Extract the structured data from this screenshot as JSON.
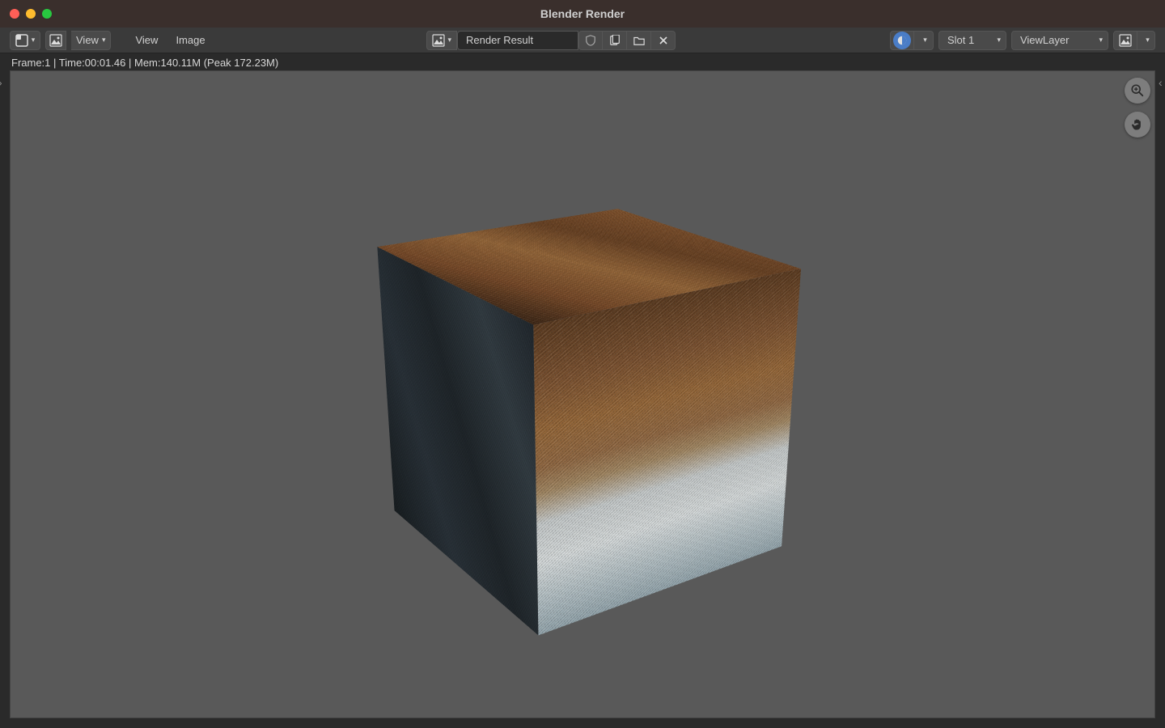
{
  "window": {
    "title": "Blender Render"
  },
  "toolbar": {
    "editor_type_icon": "image-editor-icon",
    "mode_icon": "image-mode-icon",
    "view_dropdown": "View",
    "menus": {
      "view": "View",
      "image": "Image"
    },
    "image_selector_icon": "image-datablock-icon",
    "image_name": "Render Result",
    "icons": {
      "fake_user": "shield-icon",
      "new": "new-file-icon",
      "open": "folder-icon",
      "unlink": "close-icon"
    },
    "display_channels_icon": "color-icon",
    "slot": "Slot 1",
    "layer": "ViewLayer",
    "viewport_shading_icon": "rendered-shading-icon"
  },
  "status": {
    "text": "Frame:1 | Time:00:01.46 | Mem:140.11M (Peak 172.23M)"
  },
  "render": {
    "object": "cube",
    "texture": "fur"
  },
  "overlay": {
    "zoom_icon": "magnify-plus-icon",
    "pan_icon": "hand-icon"
  }
}
